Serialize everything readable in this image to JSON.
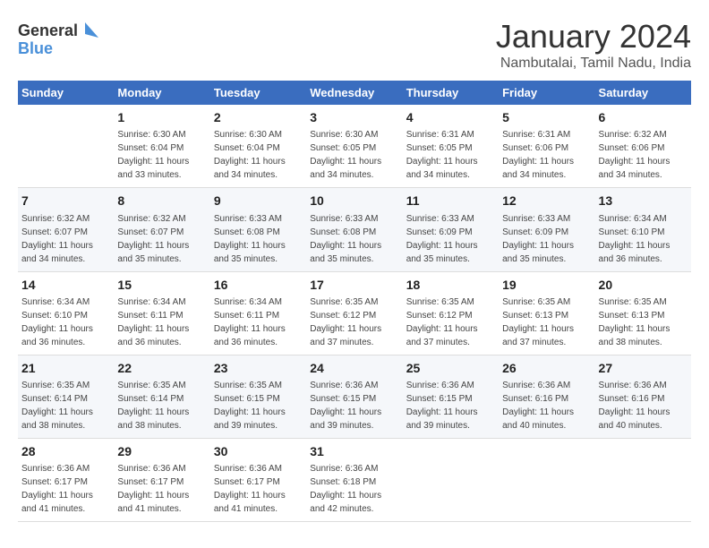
{
  "logo": {
    "general": "General",
    "blue": "Blue"
  },
  "title": "January 2024",
  "subtitle": "Nambutalai, Tamil Nadu, India",
  "days_of_week": [
    "Sunday",
    "Monday",
    "Tuesday",
    "Wednesday",
    "Thursday",
    "Friday",
    "Saturday"
  ],
  "weeks": [
    [
      {
        "day": "",
        "info": ""
      },
      {
        "day": "1",
        "info": "Sunrise: 6:30 AM\nSunset: 6:04 PM\nDaylight: 11 hours\nand 33 minutes."
      },
      {
        "day": "2",
        "info": "Sunrise: 6:30 AM\nSunset: 6:04 PM\nDaylight: 11 hours\nand 34 minutes."
      },
      {
        "day": "3",
        "info": "Sunrise: 6:30 AM\nSunset: 6:05 PM\nDaylight: 11 hours\nand 34 minutes."
      },
      {
        "day": "4",
        "info": "Sunrise: 6:31 AM\nSunset: 6:05 PM\nDaylight: 11 hours\nand 34 minutes."
      },
      {
        "day": "5",
        "info": "Sunrise: 6:31 AM\nSunset: 6:06 PM\nDaylight: 11 hours\nand 34 minutes."
      },
      {
        "day": "6",
        "info": "Sunrise: 6:32 AM\nSunset: 6:06 PM\nDaylight: 11 hours\nand 34 minutes."
      }
    ],
    [
      {
        "day": "7",
        "info": "Sunrise: 6:32 AM\nSunset: 6:07 PM\nDaylight: 11 hours\nand 34 minutes."
      },
      {
        "day": "8",
        "info": "Sunrise: 6:32 AM\nSunset: 6:07 PM\nDaylight: 11 hours\nand 35 minutes."
      },
      {
        "day": "9",
        "info": "Sunrise: 6:33 AM\nSunset: 6:08 PM\nDaylight: 11 hours\nand 35 minutes."
      },
      {
        "day": "10",
        "info": "Sunrise: 6:33 AM\nSunset: 6:08 PM\nDaylight: 11 hours\nand 35 minutes."
      },
      {
        "day": "11",
        "info": "Sunrise: 6:33 AM\nSunset: 6:09 PM\nDaylight: 11 hours\nand 35 minutes."
      },
      {
        "day": "12",
        "info": "Sunrise: 6:33 AM\nSunset: 6:09 PM\nDaylight: 11 hours\nand 35 minutes."
      },
      {
        "day": "13",
        "info": "Sunrise: 6:34 AM\nSunset: 6:10 PM\nDaylight: 11 hours\nand 36 minutes."
      }
    ],
    [
      {
        "day": "14",
        "info": "Sunrise: 6:34 AM\nSunset: 6:10 PM\nDaylight: 11 hours\nand 36 minutes."
      },
      {
        "day": "15",
        "info": "Sunrise: 6:34 AM\nSunset: 6:11 PM\nDaylight: 11 hours\nand 36 minutes."
      },
      {
        "day": "16",
        "info": "Sunrise: 6:34 AM\nSunset: 6:11 PM\nDaylight: 11 hours\nand 36 minutes."
      },
      {
        "day": "17",
        "info": "Sunrise: 6:35 AM\nSunset: 6:12 PM\nDaylight: 11 hours\nand 37 minutes."
      },
      {
        "day": "18",
        "info": "Sunrise: 6:35 AM\nSunset: 6:12 PM\nDaylight: 11 hours\nand 37 minutes."
      },
      {
        "day": "19",
        "info": "Sunrise: 6:35 AM\nSunset: 6:13 PM\nDaylight: 11 hours\nand 37 minutes."
      },
      {
        "day": "20",
        "info": "Sunrise: 6:35 AM\nSunset: 6:13 PM\nDaylight: 11 hours\nand 38 minutes."
      }
    ],
    [
      {
        "day": "21",
        "info": "Sunrise: 6:35 AM\nSunset: 6:14 PM\nDaylight: 11 hours\nand 38 minutes."
      },
      {
        "day": "22",
        "info": "Sunrise: 6:35 AM\nSunset: 6:14 PM\nDaylight: 11 hours\nand 38 minutes."
      },
      {
        "day": "23",
        "info": "Sunrise: 6:35 AM\nSunset: 6:15 PM\nDaylight: 11 hours\nand 39 minutes."
      },
      {
        "day": "24",
        "info": "Sunrise: 6:36 AM\nSunset: 6:15 PM\nDaylight: 11 hours\nand 39 minutes."
      },
      {
        "day": "25",
        "info": "Sunrise: 6:36 AM\nSunset: 6:15 PM\nDaylight: 11 hours\nand 39 minutes."
      },
      {
        "day": "26",
        "info": "Sunrise: 6:36 AM\nSunset: 6:16 PM\nDaylight: 11 hours\nand 40 minutes."
      },
      {
        "day": "27",
        "info": "Sunrise: 6:36 AM\nSunset: 6:16 PM\nDaylight: 11 hours\nand 40 minutes."
      }
    ],
    [
      {
        "day": "28",
        "info": "Sunrise: 6:36 AM\nSunset: 6:17 PM\nDaylight: 11 hours\nand 41 minutes."
      },
      {
        "day": "29",
        "info": "Sunrise: 6:36 AM\nSunset: 6:17 PM\nDaylight: 11 hours\nand 41 minutes."
      },
      {
        "day": "30",
        "info": "Sunrise: 6:36 AM\nSunset: 6:17 PM\nDaylight: 11 hours\nand 41 minutes."
      },
      {
        "day": "31",
        "info": "Sunrise: 6:36 AM\nSunset: 6:18 PM\nDaylight: 11 hours\nand 42 minutes."
      },
      {
        "day": "",
        "info": ""
      },
      {
        "day": "",
        "info": ""
      },
      {
        "day": "",
        "info": ""
      }
    ]
  ]
}
